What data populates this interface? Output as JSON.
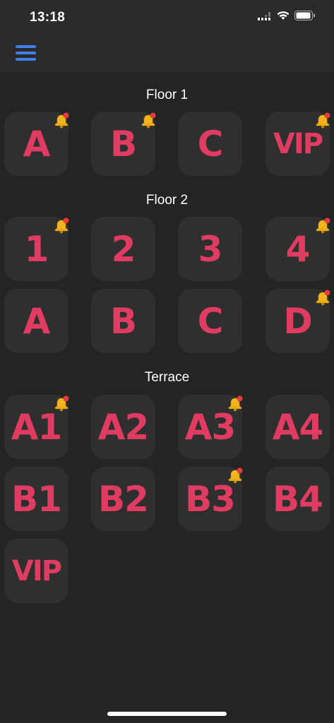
{
  "status_bar": {
    "time": "13:18"
  },
  "nav": {
    "menu_icon": "hamburger-menu-icon",
    "accent_color": "#3f7fe8"
  },
  "colors": {
    "tile_label": "#e03b60",
    "tile_bg": "#2f2f2f",
    "bell": "#f3b51f",
    "badge": "#e23c3c"
  },
  "sections": [
    {
      "title": "Floor 1",
      "tables": [
        {
          "label": "A",
          "alert": true
        },
        {
          "label": "B",
          "alert": true
        },
        {
          "label": "C",
          "alert": false
        },
        {
          "label": "VIP",
          "alert": true
        }
      ]
    },
    {
      "title": "Floor 2",
      "tables": [
        {
          "label": "1",
          "alert": true
        },
        {
          "label": "2",
          "alert": false
        },
        {
          "label": "3",
          "alert": false
        },
        {
          "label": "4",
          "alert": true
        },
        {
          "label": "A",
          "alert": false
        },
        {
          "label": "B",
          "alert": false
        },
        {
          "label": "C",
          "alert": false
        },
        {
          "label": "D",
          "alert": true
        }
      ]
    },
    {
      "title": "Terrace",
      "tables": [
        {
          "label": "A1",
          "alert": true
        },
        {
          "label": "A2",
          "alert": false
        },
        {
          "label": "A3",
          "alert": true
        },
        {
          "label": "A4",
          "alert": false
        },
        {
          "label": "B1",
          "alert": false
        },
        {
          "label": "B2",
          "alert": false
        },
        {
          "label": "B3",
          "alert": true
        },
        {
          "label": "B4",
          "alert": false
        },
        {
          "label": "VIP",
          "alert": false
        }
      ]
    }
  ]
}
